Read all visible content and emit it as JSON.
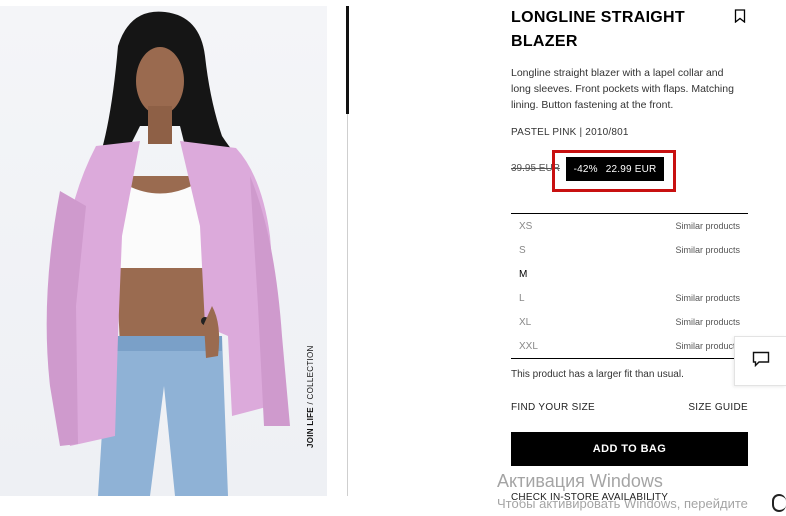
{
  "product": {
    "title": "LONGLINE STRAIGHT BLAZER",
    "description": "Longline straight blazer with a lapel collar and long sleeves. Front pockets with flaps. Matching lining. Button fastening at the front.",
    "color_ref": "PASTEL PINK | 2010/801",
    "collection_tag_bold": "JOIN LIFE",
    "collection_tag_rest": " / COLLECTION"
  },
  "price": {
    "old": "39.95 EUR",
    "discount": "-42%",
    "current": "22.99 EUR",
    "highlight_color": "#c81010"
  },
  "sizes": [
    {
      "size": "XS",
      "note": "Similar products",
      "available": false
    },
    {
      "size": "S",
      "note": "Similar products",
      "available": false
    },
    {
      "size": "M",
      "note": "",
      "available": true
    },
    {
      "size": "L",
      "note": "Similar products",
      "available": false
    },
    {
      "size": "XL",
      "note": "Similar products",
      "available": false
    },
    {
      "size": "XXL",
      "note": "Similar products",
      "available": false
    }
  ],
  "fit_note": "This product has a larger fit than usual.",
  "links": {
    "find_size": "FIND YOUR SIZE",
    "size_guide": "SIZE GUIDE",
    "check_store": "CHECK IN-STORE AVAILABILITY"
  },
  "add_to_bag": "ADD TO BAG",
  "icons": {
    "bookmark": "bookmark-icon",
    "chat": "chat-icon"
  },
  "watermark": {
    "line1": "Активация Windows",
    "line2": "Чтобы активировать Windows, перейдите"
  }
}
